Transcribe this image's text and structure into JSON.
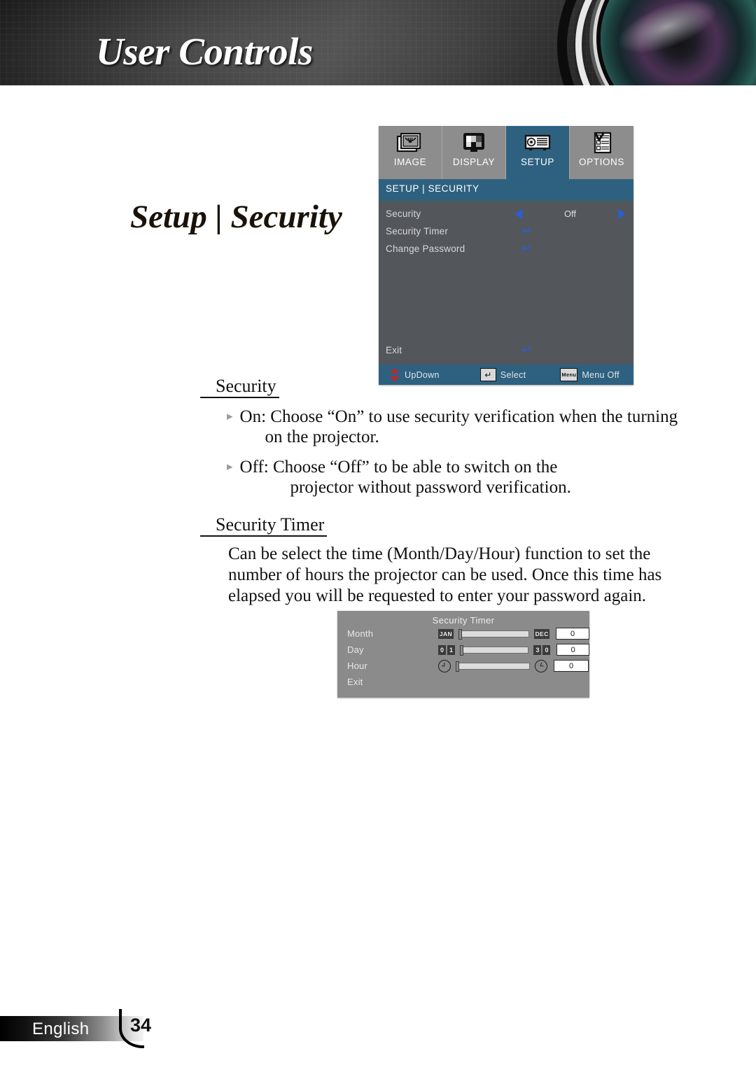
{
  "header": {
    "title": "User Controls",
    "lens_icon": "camera-lens"
  },
  "page_heading": "Setup | Security",
  "osd_menu": {
    "tabs": [
      {
        "label": "IMAGE",
        "icon": "image-icon",
        "selected": false
      },
      {
        "label": "DISPLAY",
        "icon": "display-icon",
        "selected": false
      },
      {
        "label": "SETUP",
        "icon": "setup-icon",
        "selected": true
      },
      {
        "label": "OPTIONS",
        "icon": "options-icon",
        "selected": false
      }
    ],
    "title_bar": "SETUP | SECURITY",
    "rows": [
      {
        "label": "Security",
        "value": "Off",
        "control": "left-right-arrows"
      },
      {
        "label": "Security Timer",
        "value": "",
        "control": "enter-arrow"
      },
      {
        "label": "Change Password",
        "value": "",
        "control": "enter-arrow"
      }
    ],
    "exit_row": {
      "label": "Exit",
      "control": "enter-arrow"
    },
    "help_bar": [
      {
        "icon": "up-down-arrow-icon",
        "label": "UpDown"
      },
      {
        "icon": "enter-key-icon",
        "label": "Select",
        "key": "↵"
      },
      {
        "icon": "menu-key-icon",
        "label": "Menu Off",
        "key": "Menu"
      }
    ],
    "colors": {
      "accent": "#2e6180",
      "panel": "#53565a",
      "tab_bar": "#8d8d8d",
      "arrow_blue": "#2a5fd0",
      "updown_red": "#cc2222"
    }
  },
  "sections": [
    {
      "heading": "Security",
      "bullets": [
        {
          "marker": "▸",
          "line1": "On: Choose “On” to use security verification when the turning",
          "line2": "on the projector."
        },
        {
          "marker": "▸",
          "line1": "Off: Choose “Off” to be able to switch on the",
          "line2": "projector without password verification."
        }
      ]
    },
    {
      "heading": "Security Timer",
      "paragraph": "Can be select the time (Month/Day/Hour) function to set the number of hours the projector can be used. Once this time has elapsed you will be requested to enter your password again."
    }
  ],
  "timer_dialog": {
    "title": "Security Timer",
    "rows": [
      {
        "label": "Month",
        "min_chip": "JAN",
        "max_chip": "DEC",
        "value": "0"
      },
      {
        "label": "Day",
        "min_chip": "01",
        "max_chip": "30",
        "value": "0"
      },
      {
        "label": "Hour",
        "min_chip": "clock-icon",
        "max_chip": "clock-icon",
        "value": "0"
      }
    ],
    "exit_label": "Exit"
  },
  "footer": {
    "language": "English",
    "page_number": "34"
  }
}
